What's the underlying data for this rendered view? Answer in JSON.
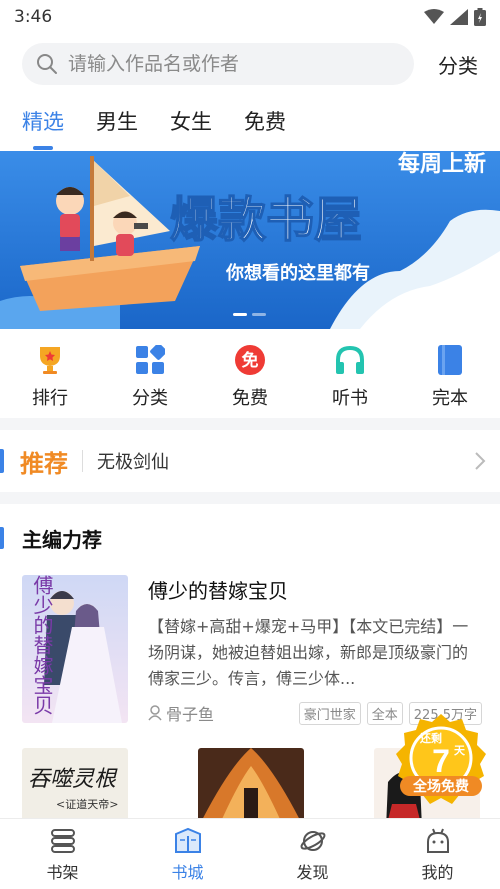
{
  "status": {
    "time": "3:46"
  },
  "search": {
    "placeholder": "请输入作品名或作者",
    "category_label": "分类"
  },
  "tabs": [
    {
      "label": "精选",
      "active": true
    },
    {
      "label": "男生",
      "active": false
    },
    {
      "label": "女生",
      "active": false
    },
    {
      "label": "免费",
      "active": false
    }
  ],
  "banner": {
    "corner_text": "每周上新",
    "headline": "爆款书屋",
    "subtitle": "你想看的这里都有",
    "page_indicator": {
      "current": 1,
      "total": 2
    }
  },
  "quick": [
    {
      "label": "排行",
      "icon": "trophy-icon",
      "color": "#f5a623"
    },
    {
      "label": "分类",
      "icon": "grid-icon",
      "color": "#3b82e6"
    },
    {
      "label": "免费",
      "icon": "free-icon",
      "icon_text": "免",
      "color": "#ef3b35"
    },
    {
      "label": "听书",
      "icon": "headphones-icon",
      "color": "#23c4b0"
    },
    {
      "label": "完本",
      "icon": "book-icon",
      "color": "#3b82e6"
    }
  ],
  "recommend": {
    "tag": "推荐",
    "title": "无极剑仙"
  },
  "section": {
    "title": "主编力荐"
  },
  "featured_book": {
    "title": "傅少的替嫁宝贝",
    "description": "【替嫁+高甜+爆宠+马甲】【本文已完结】一场阴谋，她被迫替姐出嫁，新郎是顶级豪门的傅家三少。传言，傅三少体...",
    "author": "骨子鱼",
    "tags": [
      "豪门世家",
      "全本",
      "225.5万字"
    ],
    "cover_text": "傅少的替嫁宝贝"
  },
  "more_books": [
    {
      "cover_text": "吞噬灵根",
      "cover_subtext": "<证道天帝>"
    },
    {
      "cover_text": ""
    },
    {
      "cover_text": ""
    }
  ],
  "promo": {
    "top": "还剩",
    "number": "7",
    "unit": "天",
    "bottom": "全场免费"
  },
  "bottom_nav": [
    {
      "label": "书架",
      "icon": "bookshelf-icon",
      "active": false
    },
    {
      "label": "书城",
      "icon": "bookstore-icon",
      "active": true
    },
    {
      "label": "发现",
      "icon": "discover-icon",
      "active": false
    },
    {
      "label": "我的",
      "icon": "profile-icon",
      "active": false
    }
  ],
  "colors": {
    "accent": "#3b82e6",
    "recommend": "#f08a24",
    "promo": "#f5b400"
  }
}
